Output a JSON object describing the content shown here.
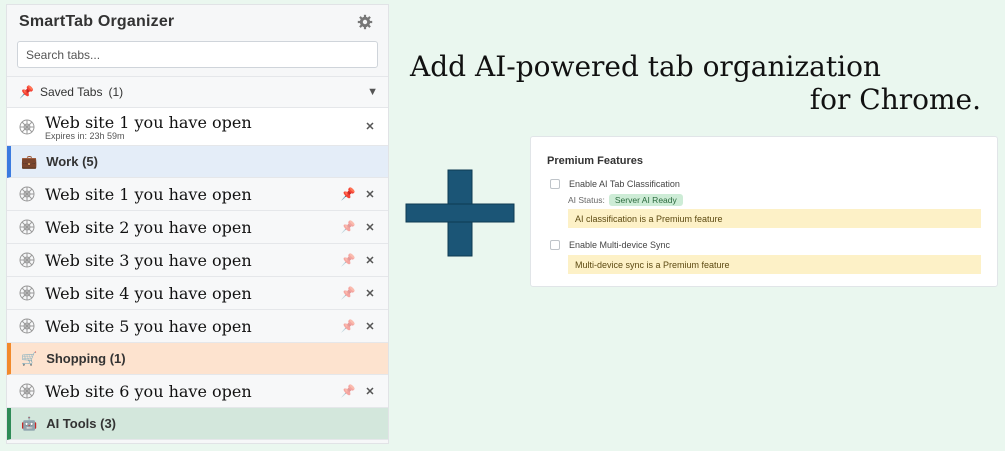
{
  "panel": {
    "title": "SmartTab Organizer",
    "settings_icon": "gear-icon",
    "search_placeholder": "Search tabs...",
    "saved_section": {
      "label": "Saved Tabs",
      "count": "(1)"
    },
    "saved_tab": {
      "title": "Web site 1 you have open",
      "expires": "Expires in: 23h 59m"
    },
    "groups": [
      {
        "name": "Work (5)",
        "icon": "briefcase-icon",
        "color": "#3b7be0",
        "tabs": [
          {
            "title": "Web site 1 you have open",
            "pinned": true
          },
          {
            "title": "Web site 2 you have open",
            "pinned": false
          },
          {
            "title": "Web site 3 you have open",
            "pinned": false
          },
          {
            "title": "Web site 4 you have open",
            "pinned": false
          },
          {
            "title": "Web site 5 you have open",
            "pinned": false
          }
        ]
      },
      {
        "name": "Shopping (1)",
        "icon": "cart-icon",
        "color": "#f28a2b",
        "tabs": [
          {
            "title": "Web site 6 you have open",
            "pinned": false
          }
        ]
      },
      {
        "name": "AI Tools (3)",
        "icon": "robot-icon",
        "color": "#2e8b57",
        "tabs": []
      }
    ]
  },
  "headline": {
    "line1": "Add AI-powered tab organization",
    "line2": "for Chrome."
  },
  "premium": {
    "title": "Premium Features",
    "ai_classification_label": "Enable AI Tab Classification",
    "ai_status_label": "AI Status:",
    "ai_status_value": "Server AI Ready",
    "ai_notice": "AI classification is a Premium feature",
    "sync_label": "Enable Multi-device Sync",
    "sync_notice": "Multi-device sync is a Premium feature"
  },
  "colors": {
    "plus": "#1b5576",
    "background": "#eaf7ef"
  }
}
